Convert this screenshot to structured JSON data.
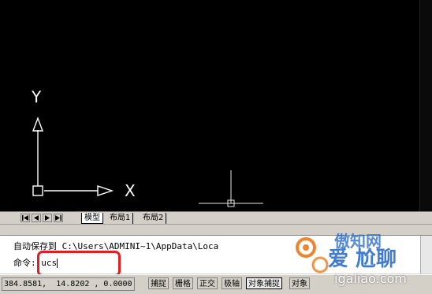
{
  "drawing": {
    "ucs_x_label": "X",
    "ucs_y_label": "Y"
  },
  "layout_tabs": {
    "nav": [
      "first-icon",
      "prev-icon",
      "next-icon",
      "last-icon"
    ],
    "items": [
      {
        "label": "模型",
        "active": true
      },
      {
        "label": "布局1",
        "active": false
      },
      {
        "label": "布局2",
        "active": false
      }
    ]
  },
  "command": {
    "history_line": "自动保存到 C:\\Users\\ADMINI~1\\AppData\\Loca",
    "prompt": "命令",
    "input": ": ucs"
  },
  "status": {
    "coordinates": "384.8581,  14.8202 , 0.0000",
    "buttons": [
      {
        "label": "捕捉",
        "on": false
      },
      {
        "label": "栅格",
        "on": false
      },
      {
        "label": "正交",
        "on": false
      },
      {
        "label": "极轴",
        "on": false
      },
      {
        "label": "对象捕捉",
        "on": true
      },
      {
        "label": "对象",
        "on": false
      }
    ]
  },
  "watermark": {
    "top": "傲知网",
    "mid": "爱 尬聊",
    "bottom": "igaliao.com"
  },
  "colors": {
    "canvas": "#000000",
    "annotation": "#e02020",
    "watermark_blue": "#1e64c8",
    "watermark_orange": "#f07818"
  }
}
